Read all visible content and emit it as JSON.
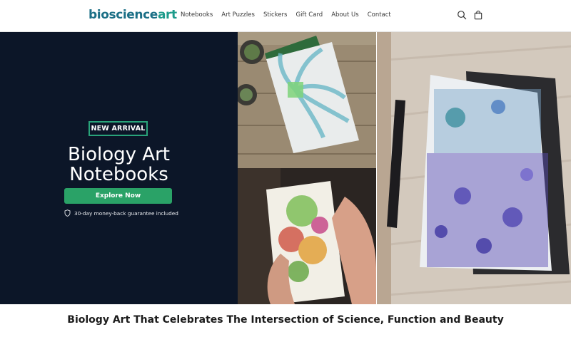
{
  "brand": {
    "part1": "bioscience",
    "part2": "art"
  },
  "nav": {
    "items": [
      "Notebooks",
      "Art Puzzles",
      "Stickers",
      "Gift Card",
      "About Us",
      "Contact"
    ]
  },
  "header_icons": {
    "search": "search-icon",
    "cart": "bag-icon"
  },
  "hero": {
    "badge": "NEW ARRIVAL",
    "title_line1": "Biology Art",
    "title_line2": "Notebooks",
    "cta_label": "Explore Now",
    "guarantee": "30-day money-back guarantee included",
    "guarantee_icon": "shield-icon"
  },
  "tagline": "Biology Art That Celebrates The Intersection of Science, Function and Beauty",
  "colors": {
    "hero_bg": "#0c1628",
    "accent_green": "#2aa267",
    "brand_teal": "#1b6f86"
  }
}
